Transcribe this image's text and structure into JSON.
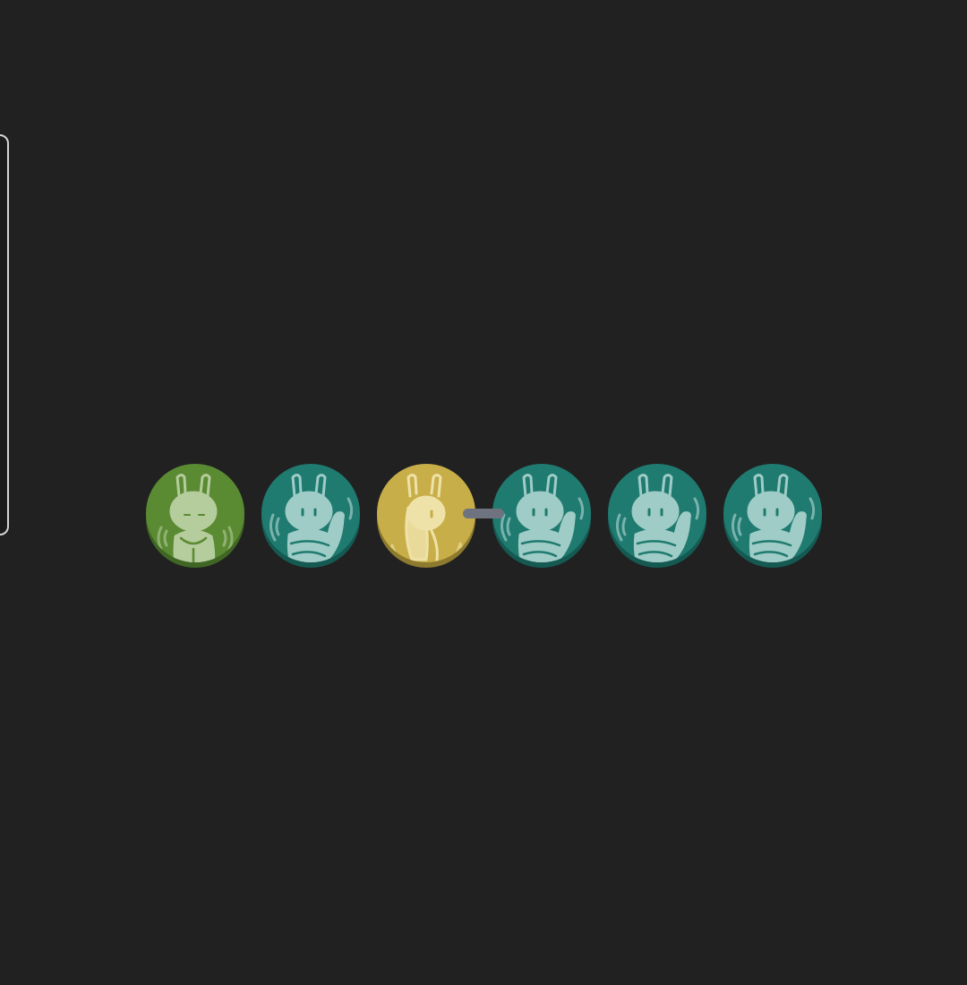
{
  "tokens": [
    {
      "state": "active",
      "pose": "standing",
      "face": "sleepy",
      "color": "#5a8a32",
      "rim": "#3f6624",
      "figure": "#b5cc9d"
    },
    {
      "state": "idle",
      "pose": "waving",
      "face": "awake",
      "color": "#1f7a70",
      "rim": "#155a52",
      "figure": "#9fccc6"
    },
    {
      "state": "selected",
      "pose": "turned",
      "face": "profile",
      "color": "#c8ae48",
      "rim": "#8e7a2e",
      "figure": "#eee2a8"
    },
    {
      "state": "idle",
      "pose": "waving",
      "face": "awake",
      "color": "#1f7a70",
      "rim": "#155a52",
      "figure": "#9fccc6"
    },
    {
      "state": "idle",
      "pose": "waving",
      "face": "awake",
      "color": "#1f7a70",
      "rim": "#155a52",
      "figure": "#9fccc6"
    },
    {
      "state": "idle",
      "pose": "waving",
      "face": "awake",
      "color": "#1f7a70",
      "rim": "#155a52",
      "figure": "#9fccc6"
    }
  ],
  "colors": {
    "background": "#212121",
    "connector": "#6f7380",
    "panel_border": "#d5d5d5"
  },
  "icons": {
    "token_figure": "rabbit-icon",
    "link": "connector-bar"
  }
}
